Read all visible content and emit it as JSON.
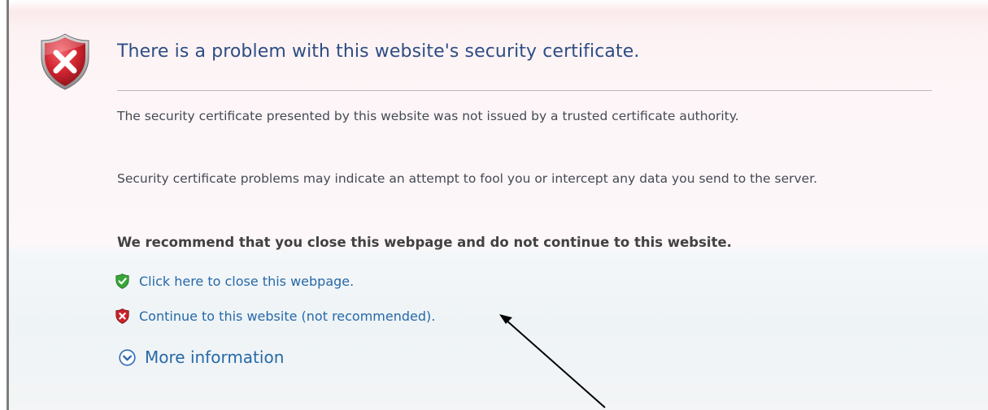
{
  "page": {
    "title": "There is a problem with this website's security certificate.",
    "paragraphs": [
      "The security certificate presented by this website was not issued by a trusted certificate authority.",
      "Security certificate problems may indicate an attempt to fool you or intercept any data you send to the server."
    ],
    "recommendation": "We recommend that you close this webpage and do not continue to this website."
  },
  "links": {
    "close": "Click here to close this webpage.",
    "continue": "Continue to this website (not recommended).",
    "more_info": "More information"
  },
  "icons": {
    "header": "error-shield-icon",
    "close": "green-check-shield-icon",
    "continue": "red-x-shield-icon",
    "more_info": "expand-chevron-circle-icon",
    "annotation": "annotation-arrow"
  },
  "colors": {
    "title": "#2d4d84",
    "link": "#2669a8",
    "body_text": "#444a54",
    "recommendation_text": "#424242",
    "error_red": "#c8232c",
    "ok_green": "#3aa53a",
    "chevron_blue": "#2f6ab6",
    "divider": "#b9b9b9",
    "window_border": "#7d7d7d"
  }
}
